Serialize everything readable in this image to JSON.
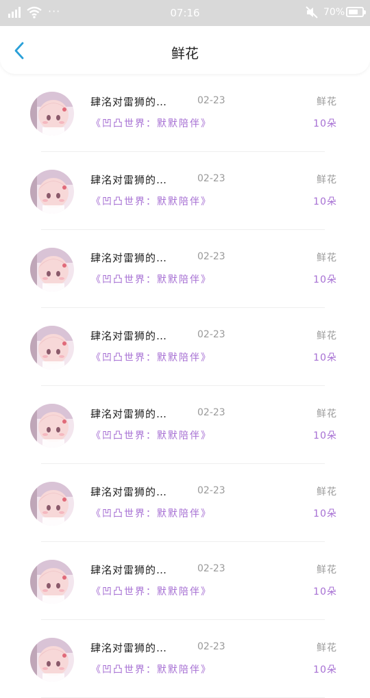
{
  "status_bar": {
    "time": "07:16",
    "battery_text": "70%",
    "battery_level": 0.7,
    "dots": "···"
  },
  "header": {
    "title": "鲜花"
  },
  "items": [
    {
      "name": "肆洺对雷狮的…",
      "date": "02-23",
      "tag": "《凹凸世界：默默陪伴》",
      "gift": "鲜花",
      "count": "10朵"
    },
    {
      "name": "肆洺对雷狮的…",
      "date": "02-23",
      "tag": "《凹凸世界：默默陪伴》",
      "gift": "鲜花",
      "count": "10朵"
    },
    {
      "name": "肆洺对雷狮的…",
      "date": "02-23",
      "tag": "《凹凸世界：默默陪伴》",
      "gift": "鲜花",
      "count": "10朵"
    },
    {
      "name": "肆洺对雷狮的…",
      "date": "02-23",
      "tag": "《凹凸世界：默默陪伴》",
      "gift": "鲜花",
      "count": "10朵"
    },
    {
      "name": "肆洺对雷狮的…",
      "date": "02-23",
      "tag": "《凹凸世界：默默陪伴》",
      "gift": "鲜花",
      "count": "10朵"
    },
    {
      "name": "肆洺对雷狮的…",
      "date": "02-23",
      "tag": "《凹凸世界：默默陪伴》",
      "gift": "鲜花",
      "count": "10朵"
    },
    {
      "name": "肆洺对雷狮的…",
      "date": "02-23",
      "tag": "《凹凸世界：默默陪伴》",
      "gift": "鲜花",
      "count": "10朵"
    },
    {
      "name": "肆洺对雷狮的…",
      "date": "02-23",
      "tag": "《凹凸世界：默默陪伴》",
      "gift": "鲜花",
      "count": "10朵"
    }
  ]
}
